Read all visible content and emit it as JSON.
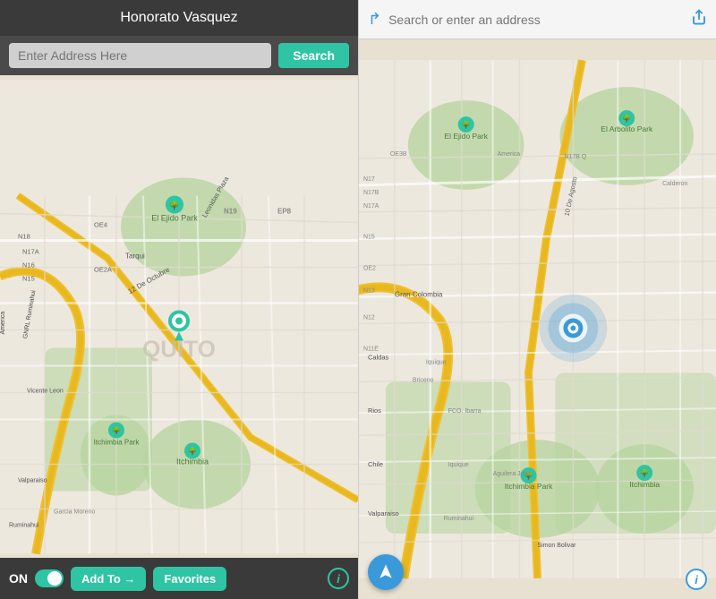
{
  "left": {
    "header": "Honorato Vasquez",
    "search_placeholder": "Enter Address Here",
    "search_button": "Search",
    "footer": {
      "on_label": "ON",
      "add_to_label": "Add To →",
      "favorites_label": "Favorites",
      "info_label": "i"
    }
  },
  "right": {
    "search_placeholder": "Search or enter an address",
    "nav_icon": "↱",
    "share_icon": "⬆",
    "info_label": "i",
    "location_icon": "navigation"
  },
  "map": {
    "city_label": "QUITO",
    "parks": [
      "El Ejido Park",
      "Itchimbia Park",
      "Itchimbia",
      "El Arbolito Park"
    ],
    "streets": [
      "N17A",
      "N16",
      "N15",
      "N12",
      "N11E",
      "N13",
      "N17B",
      "OE4",
      "OE2A",
      "OE3B",
      "America",
      "Gran Colombia",
      "Caldas",
      "Rios",
      "Chile",
      "Valparaiso",
      "Ruminahui",
      "12 De Octubre",
      "10 De Agosto",
      "Leonidas Plaza",
      "Tarqui"
    ],
    "location_dot": true,
    "location_pulse": true,
    "marker_color": "#2ec4a4"
  },
  "colors": {
    "teal": "#2ec4a4",
    "dark_header": "#3a3a3a",
    "ios_blue": "#3a9ad9",
    "map_bg": "#ede8de",
    "park_green": "#b8d4a0",
    "road_main": "#f5c842",
    "road_secondary": "#fff",
    "road_minor": "#e8e4d8",
    "water": "#b3d4e8"
  }
}
